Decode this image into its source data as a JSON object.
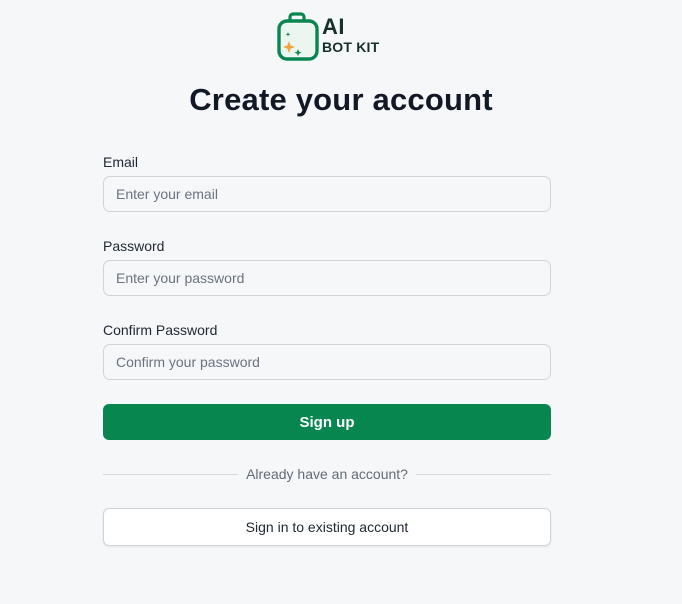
{
  "brand": {
    "line1": "AI",
    "line2": "BOT KIT",
    "icon": "bag-sparkle-icon",
    "colors": {
      "primary": "#07864f",
      "sparkle": "#f2a33a",
      "text": "#16302a"
    }
  },
  "title": "Create your account",
  "form": {
    "email": {
      "label": "Email",
      "placeholder": "Enter your email",
      "value": ""
    },
    "password": {
      "label": "Password",
      "placeholder": "Enter your password",
      "value": ""
    },
    "confirm_password": {
      "label": "Confirm Password",
      "placeholder": "Confirm your password",
      "value": ""
    },
    "submit_label": "Sign up"
  },
  "divider_text": "Already have an account?",
  "signin_label": "Sign in to existing account"
}
